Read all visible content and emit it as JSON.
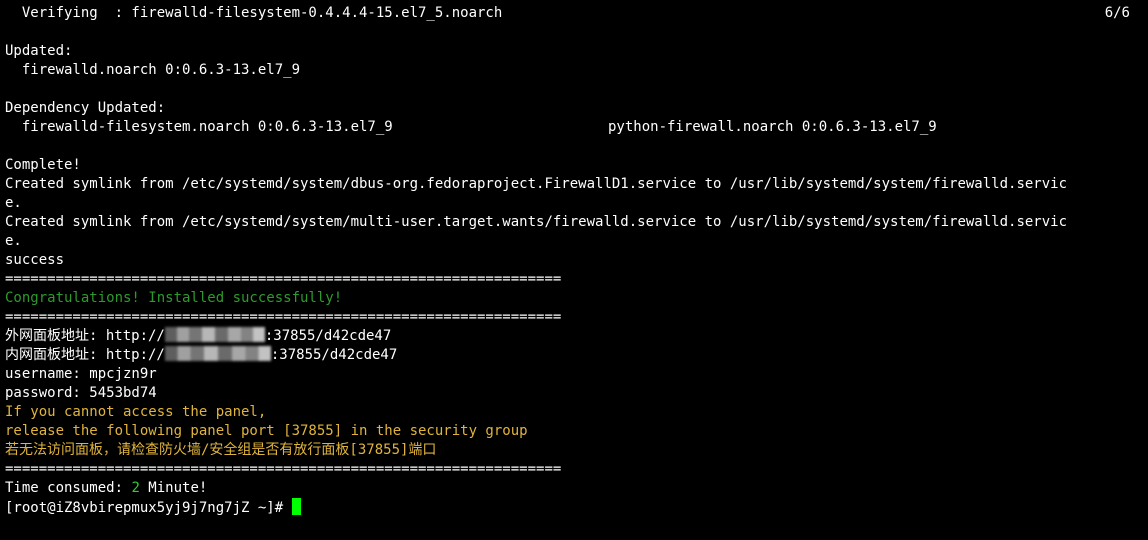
{
  "terminal": {
    "verifying": "  Verifying  : firewalld-filesystem-0.4.4.4-15.el7_5.noarch",
    "verifying_count": "6/6",
    "updated_header": "Updated:",
    "updated_pkg": "  firewalld.noarch 0:0.6.3-13.el7_9",
    "dep_header": "Dependency Updated:",
    "dep_pkg1": "  firewalld-filesystem.noarch 0:0.6.3-13.el7_9",
    "dep_pkg2": "python-firewall.noarch 0:0.6.3-13.el7_9",
    "complete": "Complete!",
    "symlink1_a": "Created symlink from /etc/systemd/system/dbus-org.fedoraproject.FirewallD1.service to /usr/lib/systemd/system/firewalld.servic",
    "symlink1_b": "e.",
    "symlink2_a": "Created symlink from /etc/systemd/system/multi-user.target.wants/firewalld.service to /usr/lib/systemd/system/firewalld.servic",
    "symlink2_b": "e.",
    "success": "success",
    "separator": "==================================================================",
    "congrats": "Congratulations! Installed successfully!",
    "ext_label": "外网面板地址: http://",
    "ext_suffix": ":37855/d42cde47",
    "int_label": "内网面板地址: http://",
    "int_suffix": ":37855/d42cde47",
    "username": "username: mpcjzn9r",
    "password": "password: 5453bd74",
    "warn1": "If you cannot access the panel,",
    "warn2": "release the following panel port [37855] in the security group",
    "warn3": "若无法访问面板，请检查防火墙/安全组是否有放行面板[37855]端口",
    "time_prefix": "Time consumed: ",
    "time_value": "2",
    "time_suffix": " Minute!",
    "prompt": "[root@iZ8vbirepmux5yj9j7ng7jZ ~]# "
  },
  "colors": {
    "background": "#000000",
    "text": "#ffffff",
    "success_green": "#2e9a2e",
    "warning_yellow": "#e0b43c",
    "cursor_green": "#00ff00"
  }
}
